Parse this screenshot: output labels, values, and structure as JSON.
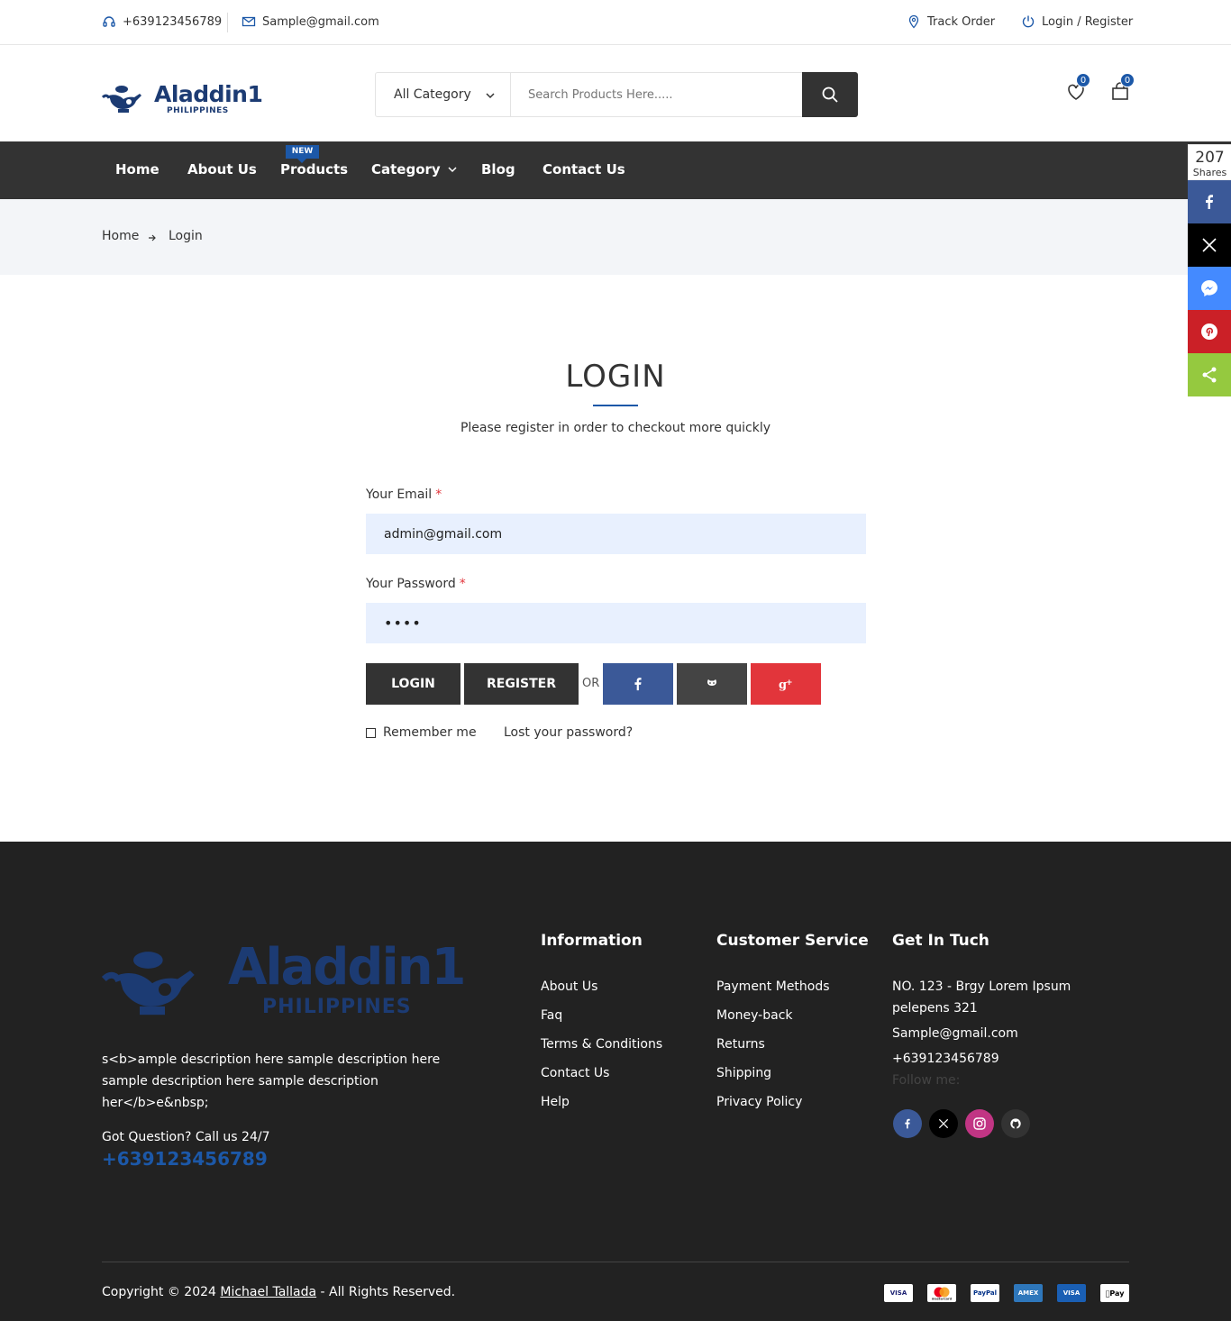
{
  "topbar": {
    "phone": "+639123456789",
    "email": "Sample@gmail.com",
    "track_order": "Track Order",
    "login_register": "Login / Register"
  },
  "header": {
    "logo_text": "Aladdin1",
    "logo_sub": "PHILIPPINES",
    "category_select": "All Category",
    "search_placeholder": "Search Products Here.....",
    "wishlist_count": "0",
    "cart_count": "0"
  },
  "nav": {
    "items": [
      "Home",
      "About Us",
      "Products",
      "Category",
      "Blog",
      "Contact Us"
    ],
    "new_tag": "NEW"
  },
  "breadcrumb": {
    "home": "Home",
    "current": "Login"
  },
  "share": {
    "count": "207",
    "label": "Shares"
  },
  "login": {
    "title": "LOGIN",
    "subtitle": "Please register in order to checkout more quickly",
    "email_label": "Your Email",
    "email_value": "admin@gmail.com",
    "password_label": "Your Password",
    "password_value": "••••",
    "required_mark": "*",
    "login_button": "LOGIN",
    "register_button": "REGISTER",
    "or_text": "OR",
    "remember_me": "Remember me",
    "lost_password": "Lost your password?"
  },
  "footer": {
    "description": "s<b>ample description here sample description here sample description here sample description her</b>e&nbsp;",
    "question": "Got Question? Call us 24/7",
    "phone": "+639123456789",
    "information": {
      "heading": "Information",
      "links": [
        "About Us",
        "Faq",
        "Terms & Conditions",
        "Contact Us",
        "Help"
      ]
    },
    "customer_service": {
      "heading": "Customer Service",
      "links": [
        "Payment Methods",
        "Money-back",
        "Returns",
        "Shipping",
        "Privacy Policy"
      ]
    },
    "contact": {
      "heading": "Get In Tuch",
      "address_line1": "NO. 123 - Brgy Lorem Ipsum",
      "address_line2": "pelepens 321",
      "email": "Sample@gmail.com",
      "phone": "+639123456789",
      "follow": "Follow me:"
    },
    "copyright_prefix": "Copyright © 2024 ",
    "copyright_name": "Michael Tallada",
    "copyright_suffix": " - All Rights Reserved.",
    "payments": [
      "VISA",
      "mastercard",
      "PayPal",
      "AMEX",
      "VISA",
      "Pay"
    ]
  },
  "colors": {
    "accent": "#1c58a8",
    "dark": "#333333",
    "footer_bg": "#222222",
    "facebook": "#3b5998",
    "google_plus": "#e2353b",
    "twitter_x": "#000000",
    "messenger": "#448aff",
    "pinterest": "#cb2027",
    "share": "#95c93f"
  }
}
